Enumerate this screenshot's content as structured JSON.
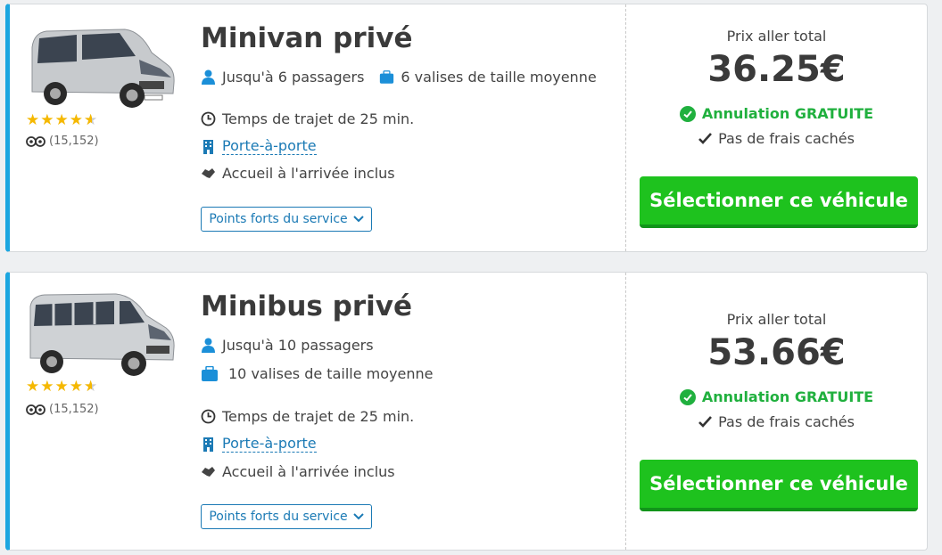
{
  "colors": {
    "accent": "#1ba6e0",
    "green": "#1ec21e",
    "link": "#1b7ab5",
    "star": "#f5b800"
  },
  "vehicles": [
    {
      "name": "Minivan privé",
      "passengers": "Jusqu'à 6 passagers",
      "luggage": "6 valises de taille moyenne",
      "rating": 4.5,
      "reviews": "(15,152)",
      "travel_time": "Temps de trajet de 25 min.",
      "door_to_door": "Porte-à-porte",
      "meet_greet": "Accueil à l'arrivée inclus",
      "service_button": "Points forts du service",
      "price_label": "Prix aller total",
      "price": "36.25€",
      "cancellation": "Annulation GRATUITE",
      "no_fees": "Pas de frais cachés",
      "select_button": "Sélectionner ce véhicule"
    },
    {
      "name": "Minibus privé",
      "passengers": "Jusqu'à 10 passagers",
      "luggage": "10 valises de taille moyenne",
      "rating": 4.5,
      "reviews": "(15,152)",
      "travel_time": "Temps de trajet de 25 min.",
      "door_to_door": "Porte-à-porte",
      "meet_greet": "Accueil à l'arrivée inclus",
      "service_button": "Points forts du service",
      "price_label": "Prix aller total",
      "price": "53.66€",
      "cancellation": "Annulation GRATUITE",
      "no_fees": "Pas de frais cachés",
      "select_button": "Sélectionner ce véhicule"
    }
  ]
}
